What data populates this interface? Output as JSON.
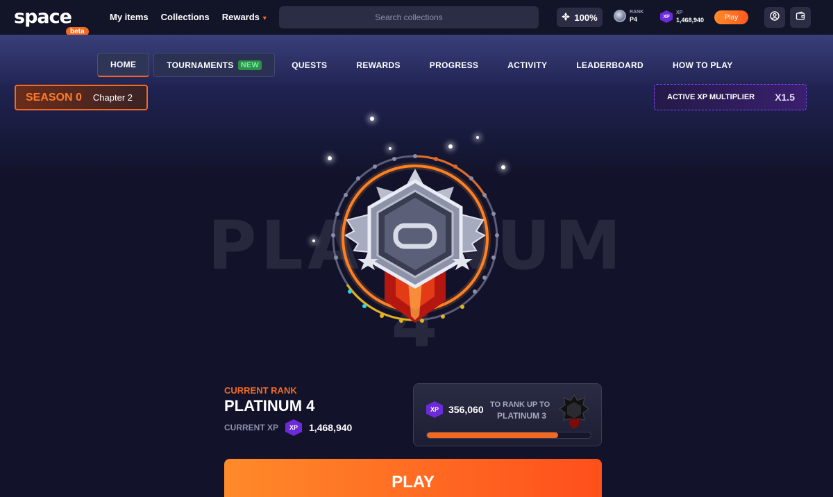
{
  "header": {
    "logo_text": "space",
    "logo_badge": "beta",
    "nav": [
      {
        "label": "My items"
      },
      {
        "label": "Collections"
      },
      {
        "label": "Rewards"
      }
    ],
    "search_placeholder": "Search collections",
    "percent": "100%",
    "rank_label": "RANK",
    "rank_value": "P4",
    "xp_label": "XP",
    "xp_value": "1,468,940",
    "play_label": "Play"
  },
  "tabs": [
    {
      "label": "HOME",
      "active": true
    },
    {
      "label": "TOURNAMENTS",
      "badge": "NEW"
    },
    {
      "label": "QUESTS"
    },
    {
      "label": "REWARDS"
    },
    {
      "label": "PROGRESS"
    },
    {
      "label": "ACTIVITY"
    },
    {
      "label": "LEADERBOARD"
    },
    {
      "label": "HOW TO PLAY"
    }
  ],
  "season": {
    "label": "SEASON 0",
    "chapter": "Chapter 2"
  },
  "multiplier": {
    "label": "ACTIVE XP MULTIPLIER",
    "value": "X1.5"
  },
  "hero": {
    "big_text": "PLATINUM 4"
  },
  "current": {
    "label": "CURRENT RANK",
    "rank": "PLATINUM 4",
    "xp_label": "CURRENT XP",
    "xp_icon": "XP",
    "xp_value": "1,468,940"
  },
  "next": {
    "xp_icon": "XP",
    "xp_needed": "356,060",
    "line1": "TO RANK UP TO",
    "line2": "PLATINUM 3",
    "progress": 0.8
  },
  "play_button": "PLAY",
  "colors": {
    "accent": "#f26a22",
    "xp_purple": "#6c2bd9",
    "background": "#12132b"
  }
}
